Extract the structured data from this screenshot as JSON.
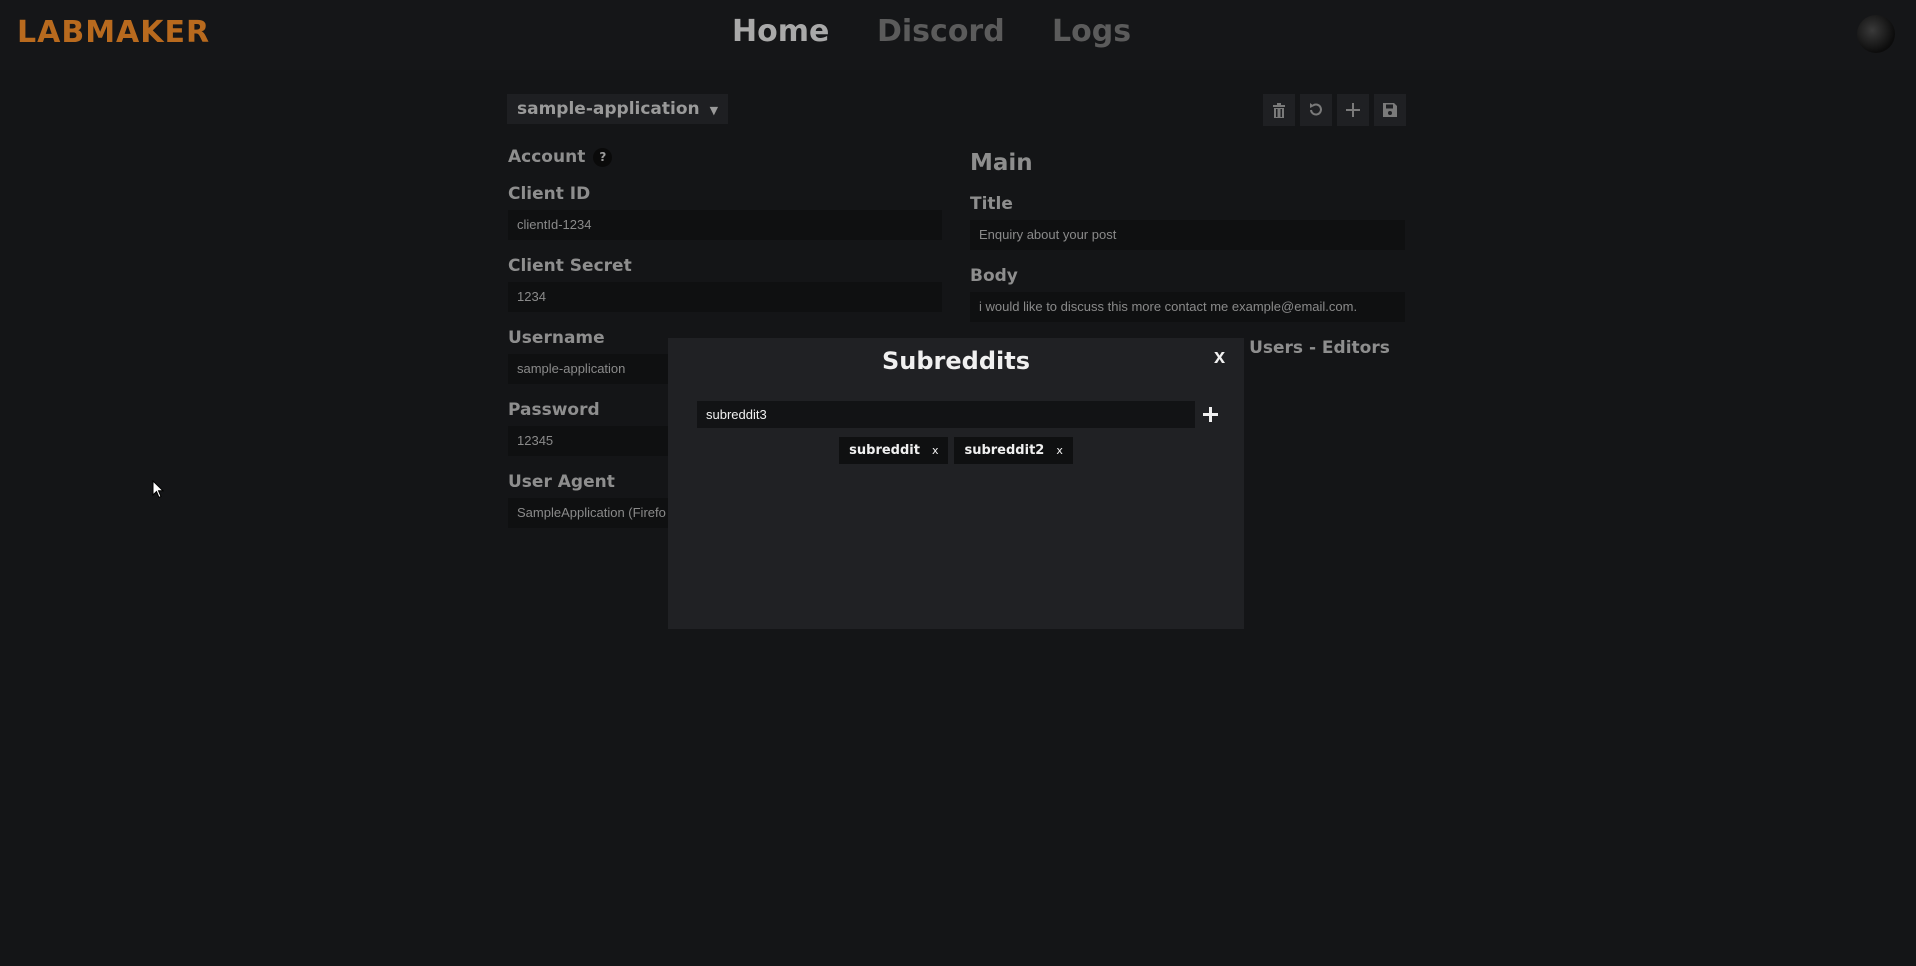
{
  "header": {
    "logo": "LABMAKER",
    "nav": [
      {
        "label": "Home"
      },
      {
        "label": "Discord"
      },
      {
        "label": "Logs"
      }
    ]
  },
  "app_selector": {
    "value": "sample-application"
  },
  "toolbar": {
    "icons": [
      "trash-icon",
      "undo-icon",
      "plus-icon",
      "save-icon"
    ]
  },
  "account": {
    "title": "Account",
    "help": "?",
    "fields": [
      {
        "label": "Client ID",
        "value": "clientId-1234"
      },
      {
        "label": "Client Secret",
        "value": "1234"
      },
      {
        "label": "Username",
        "value": "sample-application"
      },
      {
        "label": "Password",
        "value": "12345"
      },
      {
        "label": "User Agent",
        "value": "SampleApplication (Firefo"
      }
    ]
  },
  "main": {
    "title": "Main",
    "title_label": "Title",
    "title_value": "Enquiry about your post",
    "body_label": "Body",
    "body_value": "i would like to discuss this more contact me example@email.com.",
    "partial_label": "d Users - Editors"
  },
  "modal": {
    "title": "Subreddits",
    "close": "x",
    "input_value": "subreddit3",
    "tags": [
      {
        "label": "subreddit",
        "remove": "x"
      },
      {
        "label": "subreddit2",
        "remove": "x"
      }
    ]
  },
  "colors": {
    "background": "#141517",
    "logo": "#b86a1e",
    "nav_active": "#a9a9a9",
    "nav_inactive": "#5b5b5b",
    "modal": "#202124"
  }
}
